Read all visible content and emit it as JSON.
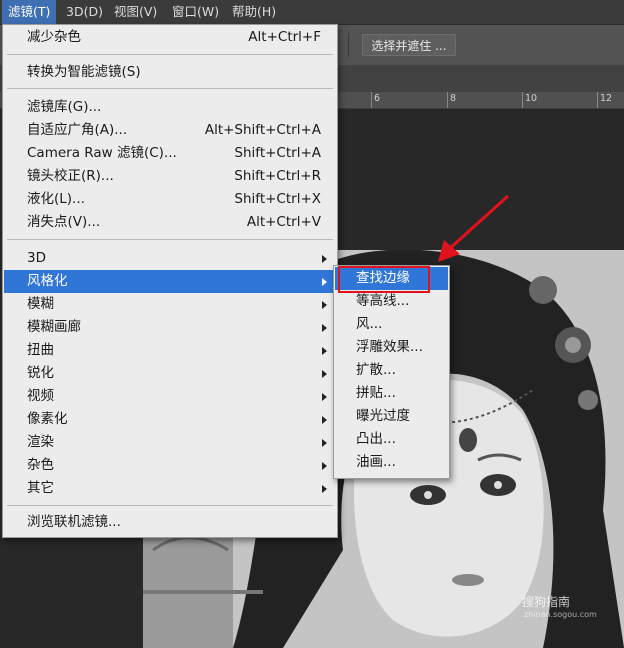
{
  "menubar": {
    "items": [
      "滤镜(T)",
      "3D(D)",
      "视图(V)",
      "窗口(W)",
      "帮助(H)"
    ]
  },
  "options_bar": {
    "select_mask_label": "选择并遮住 ..."
  },
  "ruler": {
    "ticks": [
      "6",
      "8",
      "10",
      "12"
    ]
  },
  "filter_menu": {
    "last_filter": {
      "label": "减少杂色",
      "shortcut": "Alt+Ctrl+F"
    },
    "smart": {
      "label": "转换为智能滤镜(S)"
    },
    "group1": [
      {
        "label": "滤镜库(G)...",
        "shortcut": ""
      },
      {
        "label": "自适应广角(A)...",
        "shortcut": "Alt+Shift+Ctrl+A"
      },
      {
        "label": "Camera Raw 滤镜(C)...",
        "shortcut": "Shift+Ctrl+A"
      },
      {
        "label": "镜头校正(R)...",
        "shortcut": "Shift+Ctrl+R"
      },
      {
        "label": "液化(L)...",
        "shortcut": "Shift+Ctrl+X"
      },
      {
        "label": "消失点(V)...",
        "shortcut": "Alt+Ctrl+V"
      }
    ],
    "submenus": [
      "3D",
      "风格化",
      "模糊",
      "模糊画廊",
      "扭曲",
      "锐化",
      "视频",
      "像素化",
      "渲染",
      "杂色",
      "其它"
    ],
    "browse": {
      "label": "浏览联机滤镜..."
    }
  },
  "stylize_submenu": {
    "items": [
      "查找边缘",
      "等高线...",
      "风...",
      "浮雕效果...",
      "扩散...",
      "拼贴...",
      "曝光过度",
      "凸出...",
      "油画..."
    ]
  },
  "watermark": {
    "text": "搜狗指南",
    "url": "zhinan.sogou.com"
  },
  "colors": {
    "highlight": "#2f76d6",
    "annotation": "#e0121e",
    "menu_bg": "#ececec"
  }
}
